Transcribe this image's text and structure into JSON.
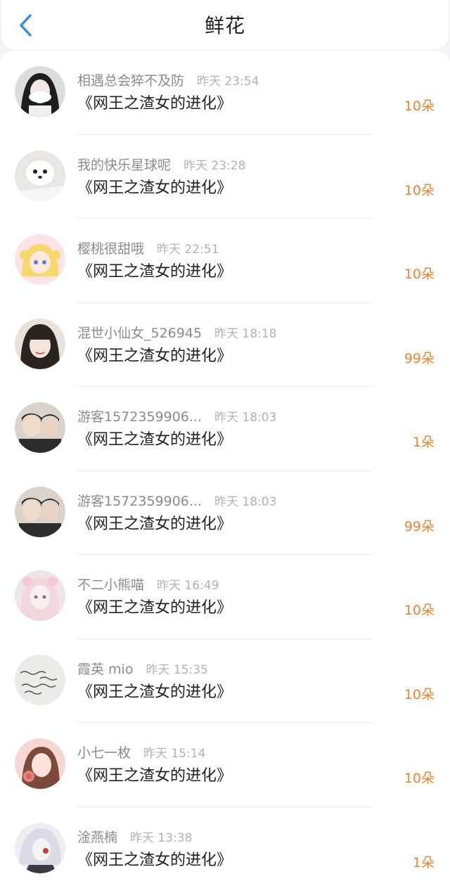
{
  "header": {
    "title": "鲜花",
    "back_icon": "chevron-left-icon",
    "accent": "#3a8ee6"
  },
  "colors": {
    "count": "#f0822d",
    "username": "#8c8c8c",
    "time": "#b3b3b3"
  },
  "records": [
    {
      "username": "相遇总会猝不及防",
      "time": "昨天 23:54",
      "book": "《网王之渣女的进化》",
      "count": "10朵"
    },
    {
      "username": "我的快乐星球呢",
      "time": "昨天 23:28",
      "book": "《网王之渣女的进化》",
      "count": "10朵"
    },
    {
      "username": "樱桃很甜哦",
      "time": "昨天 22:51",
      "book": "《网王之渣女的进化》",
      "count": "10朵"
    },
    {
      "username": "混世小仙女_526945",
      "time": "昨天 18:18",
      "book": "《网王之渣女的进化》",
      "count": "99朵"
    },
    {
      "username": "游客1572359906...",
      "time": "昨天 18:03",
      "book": "《网王之渣女的进化》",
      "count": "1朵"
    },
    {
      "username": "游客1572359906...",
      "time": "昨天 18:03",
      "book": "《网王之渣女的进化》",
      "count": "99朵"
    },
    {
      "username": "不二小熊喵",
      "time": "昨天 16:49",
      "book": "《网王之渣女的进化》",
      "count": "10朵"
    },
    {
      "username": "霞英 mio",
      "time": "昨天 15:35",
      "book": "《网王之渣女的进化》",
      "count": "10朵"
    },
    {
      "username": "小七一枚",
      "time": "昨天 15:14",
      "book": "《网王之渣女的进化》",
      "count": "10朵"
    },
    {
      "username": "淦燕楠",
      "time": "昨天 13:38",
      "book": "《网王之渣女的进化》",
      "count": "1朵"
    }
  ]
}
